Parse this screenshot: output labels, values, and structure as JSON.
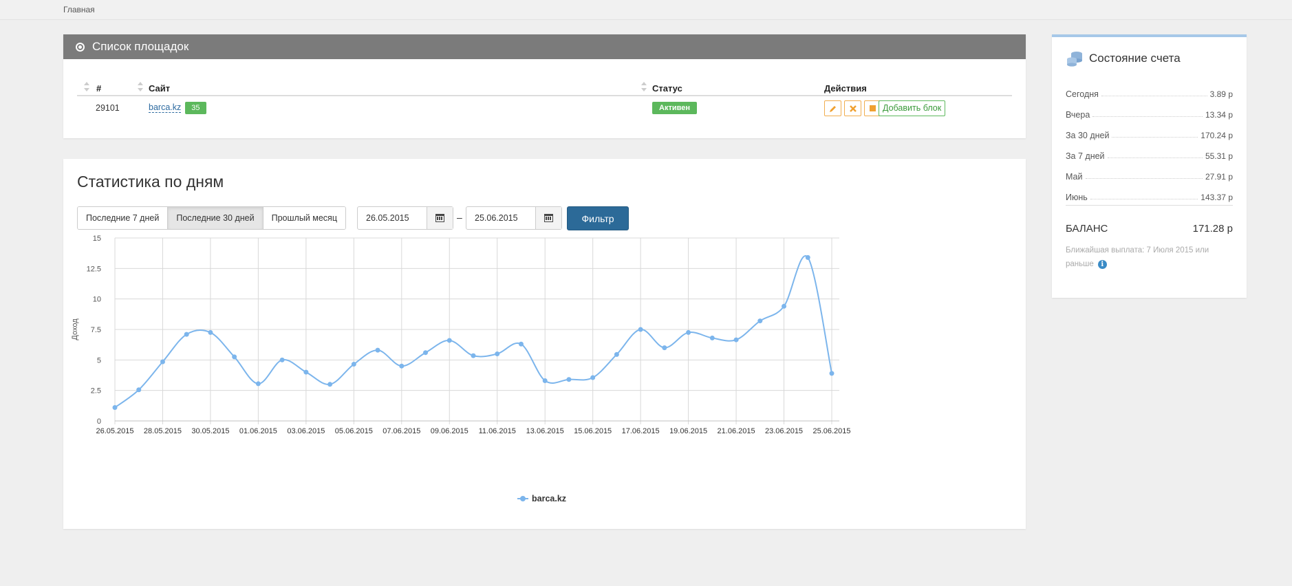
{
  "breadcrumb": {
    "home": "Главная"
  },
  "sites": {
    "title": "Список площадок",
    "columns": {
      "id": "#",
      "site": "Сайт",
      "status": "Статус",
      "actions": "Действия"
    },
    "rows": [
      {
        "id": "29101",
        "site": "barca.kz",
        "count": "35",
        "status": "Активен",
        "add_block": "Добавить блок"
      }
    ],
    "icons": [
      "pencil-icon",
      "close-icon",
      "stop-icon"
    ]
  },
  "stats": {
    "title": "Статистика по дням",
    "ranges": [
      "Последние 7 дней",
      "Последние 30 дней",
      "Прошлый месяц"
    ],
    "active_range": 1,
    "date_from": "26.05.2015",
    "date_sep": "–",
    "date_to": "25.06.2015",
    "filter_label": "Фильтр"
  },
  "chart_data": {
    "type": "line",
    "title": "",
    "xlabel": "",
    "ylabel": "Доход",
    "ylim": [
      0,
      15
    ],
    "yticks": [
      "0",
      "2.5",
      "5",
      "7.5",
      "10",
      "12.5",
      "15"
    ],
    "x": [
      "26.05.2015",
      "27.05.2015",
      "28.05.2015",
      "29.05.2015",
      "30.05.2015",
      "31.05.2015",
      "01.06.2015",
      "02.06.2015",
      "03.06.2015",
      "04.06.2015",
      "05.06.2015",
      "06.06.2015",
      "07.06.2015",
      "08.06.2015",
      "09.06.2015",
      "10.06.2015",
      "11.06.2015",
      "12.06.2015",
      "13.06.2015",
      "14.06.2015",
      "15.06.2015",
      "16.06.2015",
      "17.06.2015",
      "18.06.2015",
      "19.06.2015",
      "20.06.2015",
      "21.06.2015",
      "22.06.2015",
      "23.06.2015",
      "24.06.2015",
      "25.06.2015"
    ],
    "x_tick_labels": [
      "26.05.2015",
      "28.05.2015",
      "30.05.2015",
      "01.06.2015",
      "03.06.2015",
      "05.06.2015",
      "07.06.2015",
      "09.06.2015",
      "11.06.2015",
      "13.06.2015",
      "15.06.2015",
      "17.06.2015",
      "19.06.2015",
      "21.06.2015",
      "23.06.2015",
      "25.06.2015"
    ],
    "series": [
      {
        "name": "barca.kz",
        "color": "#7cb5ec",
        "values": [
          1.1,
          2.55,
          4.85,
          7.1,
          7.25,
          5.25,
          3.05,
          5.0,
          4.0,
          3.0,
          4.65,
          5.8,
          4.5,
          5.6,
          6.6,
          5.35,
          5.5,
          6.3,
          3.3,
          3.4,
          3.55,
          5.45,
          7.5,
          6.0,
          7.25,
          6.8,
          6.65,
          8.2,
          9.4,
          13.4,
          3.9
        ]
      }
    ],
    "legend": "bottom-center",
    "grid": true
  },
  "account": {
    "title": "Состояние счета",
    "rows": [
      {
        "label": "Сегодня",
        "value": "3.89 р"
      },
      {
        "label": "Вчера",
        "value": "13.34 р"
      },
      {
        "label": "За 30 дней",
        "value": "170.24 р"
      },
      {
        "label": "За 7 дней",
        "value": "55.31 р"
      },
      {
        "label": "Май",
        "value": "27.91 р"
      },
      {
        "label": "Июнь",
        "value": "143.37 р"
      }
    ],
    "balance_label": "БАЛАНС",
    "balance_value": "171.28 р",
    "payout_note": "Ближайшая выплата: 7 Июля 2015 или раньше"
  }
}
